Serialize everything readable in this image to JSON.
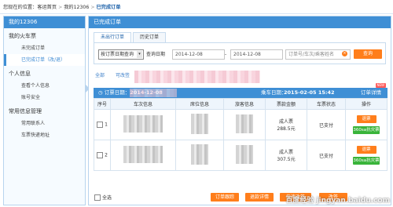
{
  "breadcrumb": {
    "prefix": "您现在的位置：",
    "items": [
      "客运首页",
      "我的12306",
      "已完成订单"
    ],
    "separator": ">"
  },
  "sidebar": {
    "title": "我的12306",
    "groups": [
      {
        "label": "我的火车票",
        "items": [
          "未完成订单",
          "已完成订单（改/退）"
        ]
      },
      {
        "label": "个人信息",
        "items": [
          "查看个人信息",
          "账号安全"
        ]
      },
      {
        "label": "常用信息管理",
        "items": [
          "常用联系人",
          "车票快递地址"
        ]
      }
    ]
  },
  "main": {
    "title": "已完成订单",
    "tabs": [
      "未出行订单",
      "历史订单"
    ],
    "filter": {
      "query_type": "按订票日期查询",
      "date_type": "查询日期",
      "date_from": "2014-12-08",
      "date_to": "2014-12-08",
      "date_sep": "-",
      "keyword_placeholder": "订单号/车次/乘客姓名",
      "search_label": "查询"
    },
    "subtabs": [
      "全部",
      "可改签"
    ],
    "order_bar": {
      "order_date_label": "订票日期：",
      "order_date": "2014-12-08",
      "depart_label": "乘车日期：",
      "depart": "2015-02-05 15:42",
      "detail_label": "订单详情",
      "new_tag": "NEW"
    },
    "columns": [
      "序号",
      "车次信息",
      "席位信息",
      "旅客信息",
      "票款金额",
      "车票状态",
      "操作"
    ],
    "rows": [
      {
        "seq": "1",
        "ticket_type": "成人票",
        "price": "288.5元",
        "status": "已支付",
        "action1": "退票",
        "action2": "360sa抗灾票"
      },
      {
        "seq": "2",
        "ticket_type": "成人票",
        "price": "307.5元",
        "status": "已支付",
        "action1": "退票",
        "action2": "360sa抗灾票"
      }
    ],
    "footer": {
      "select_all": "全选",
      "buttons": [
        "订单跟踪",
        "退款详情",
        "快速改签",
        "改签"
      ]
    }
  },
  "watermark": "百度经验 jingyan.baidu.com",
  "colors": {
    "primary": "#3f8fd5",
    "accent": "#ff7e1b",
    "green": "#39b43a"
  }
}
